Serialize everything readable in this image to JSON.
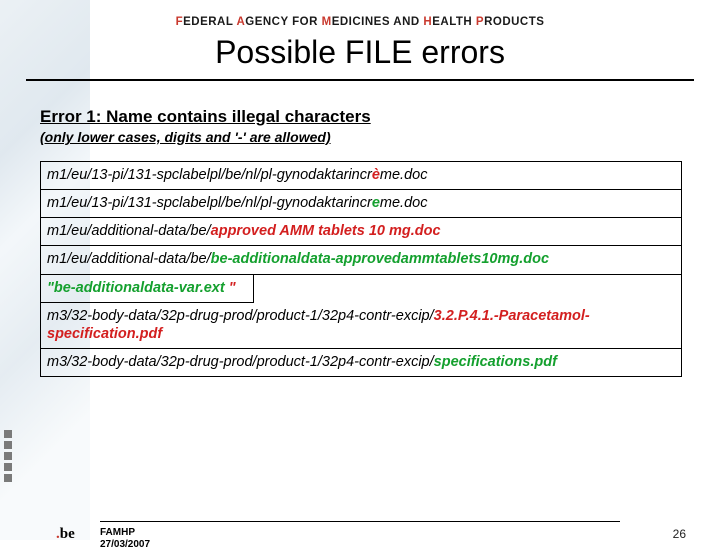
{
  "header": {
    "agency_html_parts": [
      "F",
      "EDERAL ",
      "A",
      "GENCY FOR ",
      "M",
      "EDICINES AND ",
      "H",
      "EALTH ",
      "P",
      "RODUCTS"
    ],
    "title": "Possible FILE errors"
  },
  "error": {
    "heading": "Error 1: Name contains illegal characters",
    "sub": "(only lower cases, digits and '-' are allowed)"
  },
  "rows": [
    [
      {
        "t": "m1/eu/13-pi/131-spclabelpl/be/nl/pl-gynodaktarincr",
        "c": "black"
      },
      {
        "t": "è",
        "c": "red"
      },
      {
        "t": "me.doc",
        "c": "black"
      }
    ],
    [
      {
        "t": "m1/eu/13-pi/131-spclabelpl/be/nl/pl-gynodaktarincr",
        "c": "black"
      },
      {
        "t": "e",
        "c": "green"
      },
      {
        "t": "me.doc",
        "c": "black"
      }
    ],
    [
      {
        "t": "m1/eu/additional-data/be/",
        "c": "black"
      },
      {
        "t": "approved AMM tablets 10 mg.doc",
        "c": "red"
      }
    ],
    [
      {
        "t": "m1/eu/additional-data/be/",
        "c": "black"
      },
      {
        "t": "be-additionaldata-approvedammtablets10mg.doc",
        "c": "green"
      }
    ],
    [
      {
        "t": "\"be-additionaldata-var.ext",
        "c": "green"
      },
      {
        "t": " \"",
        "c": "red"
      }
    ],
    [
      {
        "t": "m3/32-body-data/32p-drug-prod/",
        "c": "black"
      },
      {
        "t": "product-1/",
        "c": "black"
      },
      {
        "t": "32p4-contr-excip/",
        "c": "black"
      },
      {
        "t": "3.2.P.4.1.-Paracetamol-specification.pdf",
        "c": "red"
      }
    ],
    [
      {
        "t": "m3/32-body-data/32p-drug-prod/",
        "c": "black"
      },
      {
        "t": "product-1/",
        "c": "black"
      },
      {
        "t": "32p4-contr-excip/",
        "c": "black"
      },
      {
        "t": "specifications.pdf",
        "c": "green"
      }
    ]
  ],
  "footer": {
    "org": "FAMHP",
    "date": "27/03/2007",
    "page": "26",
    "logo_dot": ".",
    "logo_text": "be"
  }
}
